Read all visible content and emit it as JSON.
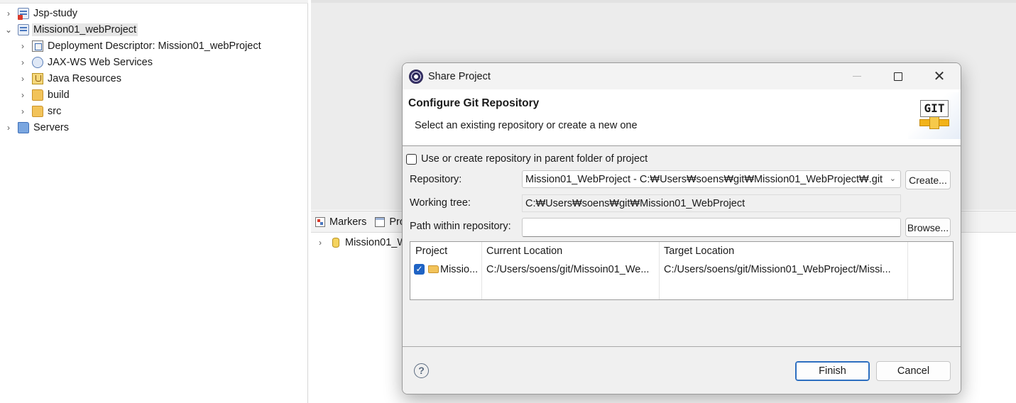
{
  "explorer": {
    "items": [
      {
        "label": "Jsp-study",
        "icon": "project-error-icon",
        "chevron": "›"
      },
      {
        "label": "Mission01_webProject",
        "icon": "project-icon",
        "chevron": "⌄"
      },
      {
        "label": "Deployment Descriptor: Mission01_webProject",
        "icon": "deployment-descriptor-icon",
        "chevron": "›"
      },
      {
        "label": "JAX-WS Web Services",
        "icon": "web-services-icon",
        "chevron": "›"
      },
      {
        "label": "Java Resources",
        "icon": "java-resources-icon",
        "chevron": "›"
      },
      {
        "label": "build",
        "icon": "folder-icon",
        "chevron": "›"
      },
      {
        "label": "src",
        "icon": "folder-icon",
        "chevron": "›"
      },
      {
        "label": "Servers",
        "icon": "folder-icon",
        "chevron": "›"
      }
    ]
  },
  "bottom_panel": {
    "tabs": [
      {
        "label": "Markers"
      },
      {
        "label": "Pro"
      }
    ],
    "row_label": "Mission01_W",
    "row_chevron": "›"
  },
  "dialog": {
    "title": "Share Project",
    "close_glyph": "✕",
    "banner": {
      "heading": "Configure Git Repository",
      "subtitle": "Select an existing repository or create a new one",
      "logo_text": "GIT"
    },
    "use_parent_label": "Use or create repository in parent folder of project",
    "repository_label": "Repository:",
    "repository_value": "Mission01_WebProject - C:₩Users₩soens₩git₩Mission01_WebProject₩.git",
    "repository_arrow": "⌄",
    "create_button": "Create...",
    "working_tree_label": "Working tree:",
    "working_tree_value": "C:₩Users₩soens₩git₩Mission01_WebProject",
    "path_label": "Path within repository:",
    "path_value": "",
    "browse_button": "Browse...",
    "table": {
      "headers": [
        "Project",
        "Current Location",
        "Target Location"
      ],
      "row": {
        "checked_glyph": "✓",
        "project": "Missio...",
        "current_location": "C:/Users/soens/git/Missoin01_We...",
        "target_location": "C:/Users/soens/git/Mission01_WebProject/Missi..."
      }
    },
    "help_glyph": "?",
    "finish_button": "Finish",
    "cancel_button": "Cancel"
  },
  "colors": {
    "accent": "#2d6fc0",
    "checkbox_checked": "#1f63c4",
    "selection": "#e6e6e6"
  }
}
